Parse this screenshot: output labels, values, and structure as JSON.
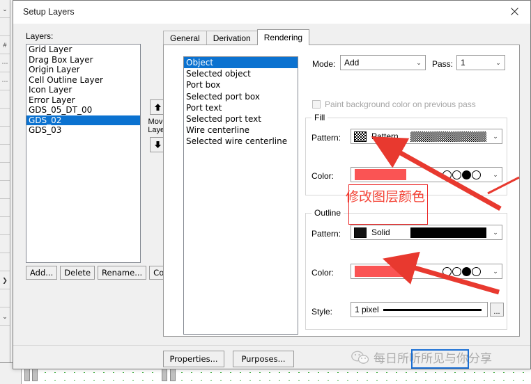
{
  "window": {
    "title": "Setup Layers",
    "close_icon": "close-icon"
  },
  "left_panel": {
    "layers_label": "Layers:",
    "layers": [
      {
        "name": "Grid Layer",
        "selected": false
      },
      {
        "name": "Drag Box Layer",
        "selected": false
      },
      {
        "name": "Origin Layer",
        "selected": false
      },
      {
        "name": "Cell Outline Layer",
        "selected": false
      },
      {
        "name": "Icon Layer",
        "selected": false
      },
      {
        "name": "Error Layer",
        "selected": false
      },
      {
        "name": "GDS_05_DT_00",
        "selected": false
      },
      {
        "name": "GDS_02",
        "selected": true
      },
      {
        "name": "GDS_03",
        "selected": false
      }
    ],
    "move_layer_label_line1": "Move",
    "move_layer_label_line2": "Layer",
    "move_up_icon": "arrow-up-icon",
    "move_down_icon": "arrow-down-icon",
    "buttons": [
      "Add...",
      "Delete",
      "Rename...",
      "Copy..."
    ]
  },
  "tabs": [
    {
      "label": "General",
      "active": false
    },
    {
      "label": "Derivation",
      "active": false
    },
    {
      "label": "Rendering",
      "active": true
    }
  ],
  "rendering": {
    "objects": [
      {
        "name": "Object",
        "selected": true
      },
      {
        "name": "Selected object",
        "selected": false
      },
      {
        "name": "Port box",
        "selected": false
      },
      {
        "name": "Selected port box",
        "selected": false
      },
      {
        "name": "Port text",
        "selected": false
      },
      {
        "name": "Selected port text",
        "selected": false
      },
      {
        "name": "Wire centerline",
        "selected": false
      },
      {
        "name": "Selected wire centerline",
        "selected": false
      }
    ],
    "mode": {
      "label": "Mode:",
      "value": "Add"
    },
    "pass": {
      "label": "Pass:",
      "value": "1"
    },
    "paint_background_checkbox": {
      "label": "Paint background color on previous pass",
      "checked": false,
      "enabled": false
    },
    "fill": {
      "group_title": "Fill",
      "pattern_label": "Pattern:",
      "pattern_value": "Pattern",
      "color_label": "Color:",
      "color_value": "#fa5454"
    },
    "outline": {
      "group_title": "Outline",
      "pattern_label": "Pattern:",
      "pattern_value": "Solid",
      "color_label": "Color:",
      "color_value": "#fa5454",
      "style_label": "Style:",
      "style_value": "1 pixel",
      "style_more_button": "..."
    }
  },
  "bottom_buttons": [
    "Properties...",
    "Purposes..."
  ],
  "annotation": {
    "text": "修改图层颜色",
    "color": "#f44336"
  },
  "watermark": {
    "icon": "wechat-icon",
    "text": "每日所听所见与你分享"
  }
}
